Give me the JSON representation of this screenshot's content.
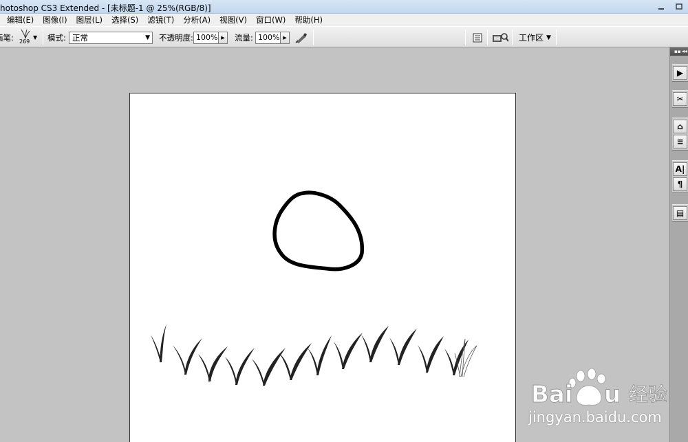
{
  "window": {
    "title": "hotoshop CS3 Extended - [未标题-1 @ 25%(RGB/8)]",
    "buttons": [
      "minimize",
      "maximize"
    ]
  },
  "menu": {
    "items": [
      "编辑(E)",
      "图像(I)",
      "图层(L)",
      "选择(S)",
      "滤镜(T)",
      "分析(A)",
      "视图(V)",
      "窗口(W)",
      "帮助(H)"
    ]
  },
  "options": {
    "brush_label": "画笔:",
    "brush_size": "269",
    "mode_label": "模式:",
    "mode_value": "正常",
    "opacity_label": "不透明度:",
    "opacity_value": "100%",
    "flow_label": "流量:",
    "flow_value": "100%",
    "workspace_label": "工作区"
  },
  "document": {
    "zoom": "25%",
    "color_mode": "RGB/8",
    "drawing": [
      "ellipse-stroke",
      "grass-brush-strokes"
    ]
  },
  "dock": {
    "icons": [
      "navigator-icon",
      "tools-icon",
      "layers-icon",
      "channels-icon",
      "character-icon",
      "paragraph-icon",
      "info-icon"
    ],
    "icon_glyphs": [
      "▶",
      "✂",
      "⌂",
      "≡",
      "A|",
      "¶",
      "▤"
    ]
  },
  "watermark": {
    "brand": "Baidu经验",
    "url": "jingyan.baidu.com"
  }
}
